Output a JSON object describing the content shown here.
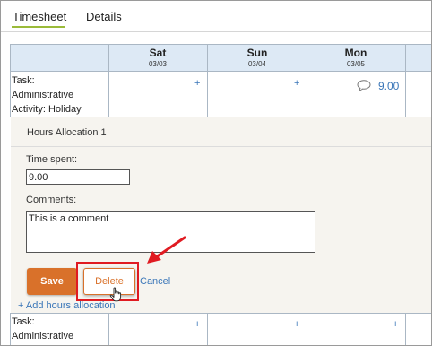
{
  "tabs": [
    {
      "label": "Timesheet",
      "active": true
    },
    {
      "label": "Details",
      "active": false
    }
  ],
  "days": [
    {
      "day": "Sat",
      "date": "03/03"
    },
    {
      "day": "Sun",
      "date": "03/04"
    },
    {
      "day": "Mon",
      "date": "03/05"
    }
  ],
  "rows": [
    {
      "task_label": "Task:",
      "task_name": "Administrative",
      "activity": "Activity: Holiday",
      "cells": [
        "+",
        "+",
        "9.00"
      ]
    },
    {
      "task_label": "Task:",
      "task_name": "Administrative",
      "cells": [
        "+",
        "+",
        "+"
      ]
    }
  ],
  "allocation": {
    "title": "Hours Allocation 1",
    "time_label": "Time spent:",
    "time_value": "9.00",
    "comments_label": "Comments:",
    "comments_value": "This is a comment",
    "save_label": "Save",
    "delete_label": "Delete",
    "cancel_label": "Cancel",
    "add_label": "+ Add hours allocation"
  },
  "colors": {
    "accent_orange": "#d9712a",
    "link_blue": "#3a76b8",
    "header_blue": "#dde9f5",
    "highlight_red": "#e01b22",
    "tab_green": "#9bbb3a"
  }
}
